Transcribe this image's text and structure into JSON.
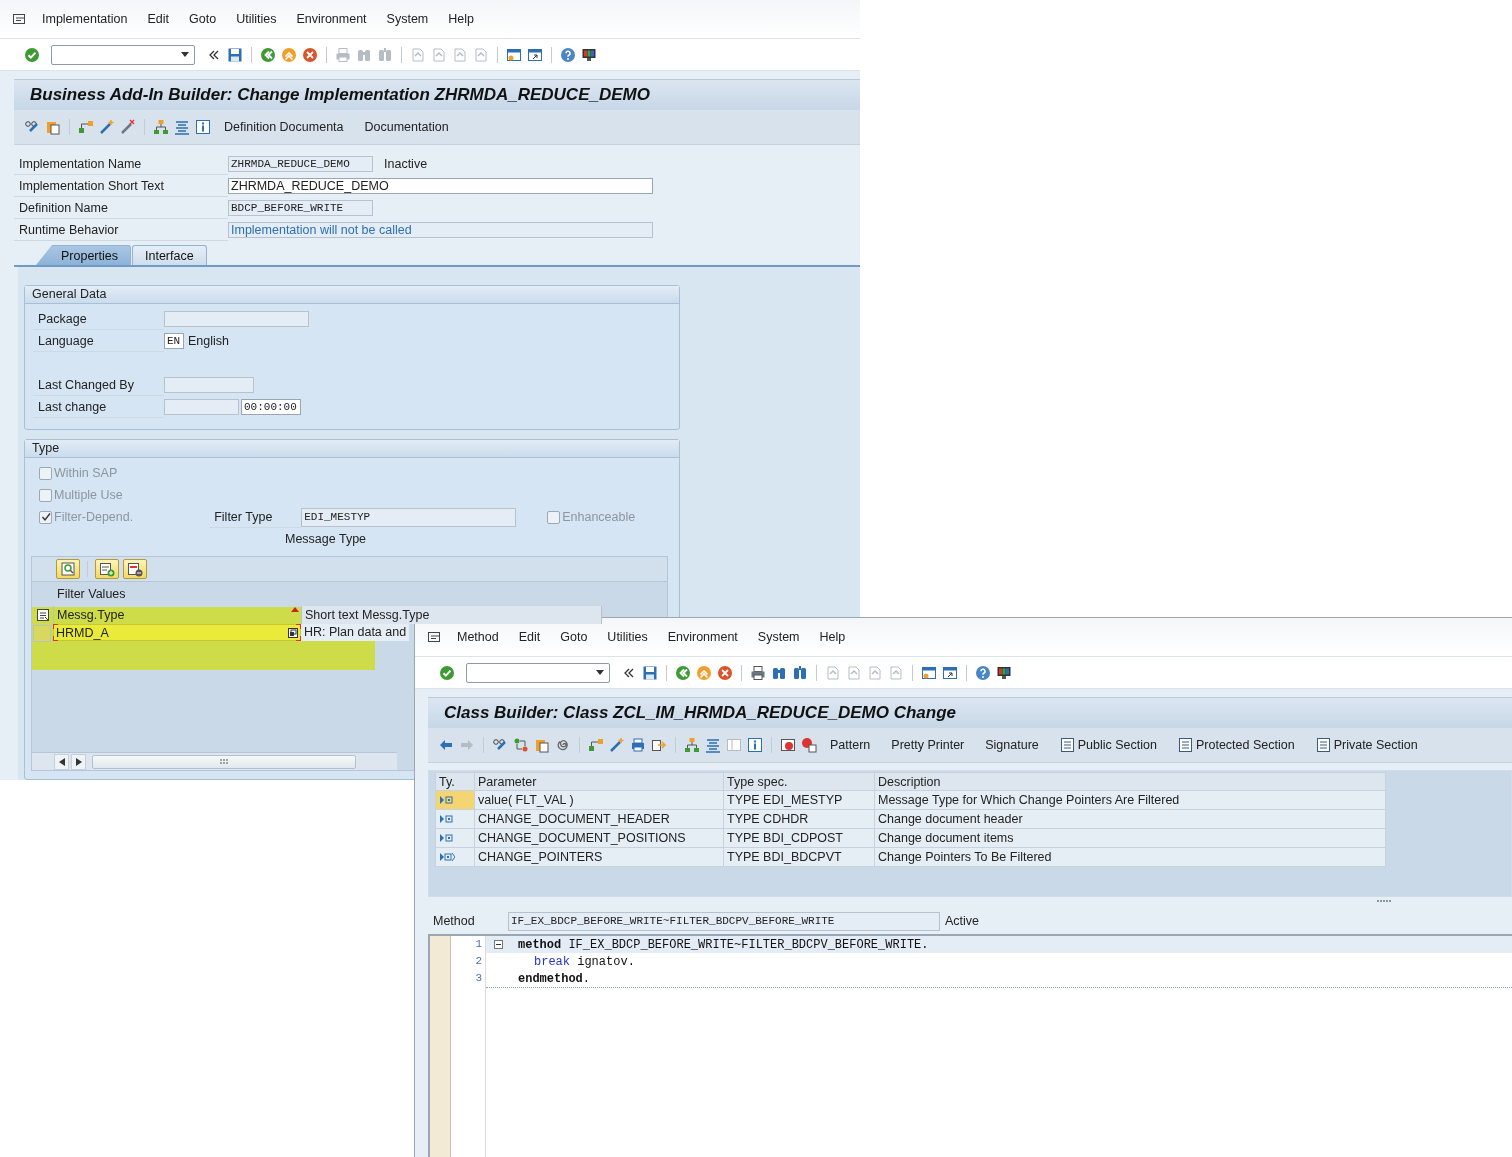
{
  "implementation_window": {
    "menu": [
      "Implementation",
      "Edit",
      "Goto",
      "Utilities",
      "Environment",
      "System",
      "Help"
    ],
    "title": "Business Add-In Builder: Change Implementation ZHRMDA_REDUCE_DEMO",
    "app_toolbar_buttons": [
      "Definition Documenta",
      "Documentation"
    ],
    "header_fields": [
      {
        "label": "Implementation Name",
        "value": "ZHRMDA_REDUCE_DEMO",
        "kind": "display",
        "status": "Inactive"
      },
      {
        "label": "Implementation Short Text",
        "value": "ZHRMDA_REDUCE_DEMO",
        "kind": "input"
      },
      {
        "label": "Definition Name",
        "value": "BDCP_BEFORE_WRITE",
        "kind": "display"
      },
      {
        "label": "Runtime Behavior",
        "value": "Implementation will not be called",
        "kind": "message"
      }
    ],
    "tabs": [
      {
        "label": "Properties",
        "selected": true
      },
      {
        "label": "Interface",
        "selected": false
      }
    ],
    "general_data": {
      "title": "General Data",
      "field_blocks": [
        [
          {
            "label": "Package",
            "kind": "wide"
          },
          {
            "label": "Language",
            "kind": "code",
            "value": "EN",
            "text": "English"
          }
        ],
        [
          {
            "label": "Last Changed By",
            "kind": "medium"
          },
          {
            "label": "Last change",
            "kind": "datetime",
            "time": "00:00:00"
          }
        ]
      ]
    },
    "type_group": {
      "title": "Type",
      "checkboxes": [
        {
          "label": "Within SAP",
          "checked": false
        },
        {
          "label": "Multiple Use",
          "checked": false
        },
        {
          "label": "Filter-Depend.",
          "checked": true
        }
      ],
      "filter_type": {
        "label": "Filter Type",
        "value": "EDI_MESTYP",
        "description": "Message Type"
      },
      "enhanceable": {
        "label": "Enhanceable",
        "checked": false
      },
      "filter_values": {
        "title": "Filter Values",
        "columns": [
          "Messg.Type",
          "Short text Messg.Type"
        ],
        "rows": [
          {
            "cells": [
              "HRMD_A",
              "HR: Plan data and"
            ],
            "selected": true
          }
        ]
      }
    }
  },
  "class_window": {
    "menu": [
      "Method",
      "Edit",
      "Goto",
      "Utilities",
      "Environment",
      "System",
      "Help"
    ],
    "title": "Class Builder: Class ZCL_IM_HRMDA_REDUCE_DEMO Change",
    "app_toolbar_buttons": [
      {
        "label": "Pattern",
        "kind": "text"
      },
      {
        "label": "Pretty Printer",
        "kind": "text"
      },
      {
        "label": "Signature",
        "kind": "text"
      },
      {
        "label": "Public Section",
        "kind": "section"
      },
      {
        "label": "Protected Section",
        "kind": "section"
      },
      {
        "label": "Private Section",
        "kind": "section"
      }
    ],
    "parameters": {
      "columns": [
        "Ty.",
        "Parameter",
        "Type spec.",
        "Description"
      ],
      "rows": [
        {
          "kind": "importing",
          "parameter": "value( FLT_VAL )",
          "type_spec": "TYPE EDI_MESTYP",
          "description": "Message Type  for Which Change Pointers Are Filtered",
          "selected": true
        },
        {
          "kind": "importing",
          "parameter": "CHANGE_DOCUMENT_HEADER",
          "type_spec": "TYPE CDHDR",
          "description": "Change document header",
          "selected": false
        },
        {
          "kind": "importing",
          "parameter": "CHANGE_DOCUMENT_POSITIONS",
          "type_spec": "TYPE BDI_CDPOST",
          "description": "Change document items",
          "selected": false
        },
        {
          "kind": "changing",
          "parameter": "CHANGE_POINTERS",
          "type_spec": "TYPE BDI_BDCPVT",
          "description": "Change Pointers To Be Filtered",
          "selected": false
        }
      ]
    },
    "method": {
      "label": "Method",
      "value": "IF_EX_BDCP_BEFORE_WRITE~FILTER_BDCPV_BEFORE_WRITE",
      "status": "Active"
    },
    "code": [
      {
        "number": "1",
        "selected": true,
        "expanded": true,
        "tokens": [
          {
            "kind": "keyword",
            "text": "method"
          },
          {
            "kind": "text",
            "text": " IF_EX_BDCP_BEFORE_WRITE~FILTER_BDCPV_BEFORE_WRITE."
          }
        ],
        "children": [
          {
            "number": "2",
            "selected": false,
            "tokens": [
              {
                "kind": "statement",
                "text": "break"
              },
              {
                "kind": "text",
                "text": " ignatov."
              }
            ]
          }
        ]
      },
      {
        "number": "3",
        "selected": false,
        "tokens": [
          {
            "kind": "keyword",
            "text": "endmethod"
          },
          {
            "kind": "text",
            "text": "."
          }
        ]
      }
    ]
  }
}
